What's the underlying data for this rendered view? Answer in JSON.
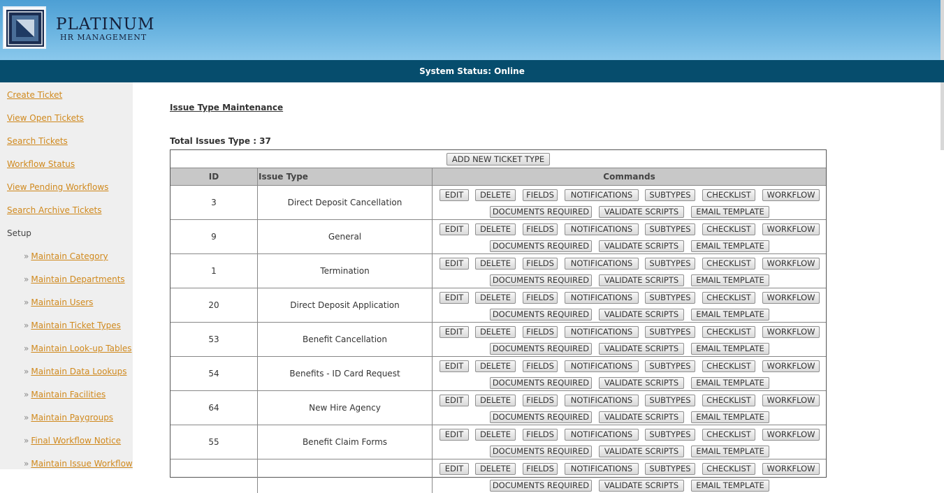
{
  "brand": {
    "name": "PLATINUM",
    "subtitle": "HR MANAGEMENT"
  },
  "status": {
    "text": "System Status: Online"
  },
  "sidebar": {
    "links": [
      {
        "label": "Create Ticket"
      },
      {
        "label": "View Open Tickets"
      },
      {
        "label": "Search Tickets"
      },
      {
        "label": "Workflow Status"
      },
      {
        "label": "View Pending Workflows"
      },
      {
        "label": "Search Archive Tickets"
      }
    ],
    "setup_label": "Setup",
    "setup_items": [
      {
        "label": "Maintain Category"
      },
      {
        "label": "Maintain Departments"
      },
      {
        "label": "Maintain Users"
      },
      {
        "label": "Maintain Ticket Types"
      },
      {
        "label": "Maintain Look-up Tables"
      },
      {
        "label": "Maintain Data Lookups"
      },
      {
        "label": "Maintain Facilities"
      },
      {
        "label": "Maintain Paygroups"
      },
      {
        "label": "Final Workflow Notice"
      },
      {
        "label": "Maintain Issue Workflow"
      }
    ],
    "raquo": "»"
  },
  "main": {
    "page_title": "Issue Type Maintenance",
    "total_label": "Total Issues Type : 37",
    "add_button": "ADD NEW TICKET TYPE",
    "headers": {
      "id": "ID",
      "issue_type": "Issue Type",
      "commands": "Commands"
    },
    "commands": {
      "edit": "EDIT",
      "delete": "DELETE",
      "fields": "FIELDS",
      "notifications": "NOTIFICATIONS",
      "subtypes": "SUBTYPES",
      "checklist": "CHECKLIST",
      "workflow": "WORKFLOW",
      "documents_required": "DOCUMENTS REQUIRED",
      "validate_scripts": "VALIDATE SCRIPTS",
      "email_template": "EMAIL TEMPLATE"
    },
    "rows": [
      {
        "id": "3",
        "issue_type": "Direct Deposit Cancellation"
      },
      {
        "id": "9",
        "issue_type": "General"
      },
      {
        "id": "1",
        "issue_type": "Termination"
      },
      {
        "id": "20",
        "issue_type": "Direct Deposit Application"
      },
      {
        "id": "53",
        "issue_type": "Benefit Cancellation"
      },
      {
        "id": "54",
        "issue_type": "Benefits - ID Card Request"
      },
      {
        "id": "64",
        "issue_type": "New Hire Agency"
      },
      {
        "id": "55",
        "issue_type": "Benefit Claim Forms"
      },
      {
        "id": "",
        "issue_type": ""
      }
    ]
  },
  "colors": {
    "header_blue": "#5aa9dc",
    "status_bar": "#064d6d",
    "link_orange": "#d0891d",
    "sidebar_bg": "#efefef",
    "table_header": "#c8c8c8"
  }
}
